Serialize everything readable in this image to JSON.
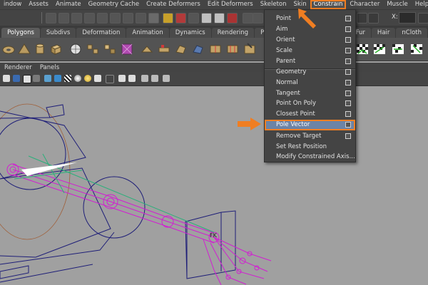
{
  "menubar": {
    "items": [
      "indow",
      "Assets",
      "Animate",
      "Geometry Cache",
      "Create Deformers",
      "Edit Deformers",
      "Skeleton",
      "Skin",
      "Constrain",
      "Character",
      "Muscle",
      "Help"
    ],
    "highlighted_index": 8
  },
  "toolbar": {
    "x_label": "X:"
  },
  "shelf_tabs": [
    "Polygons",
    "Subdivs",
    "Deformation",
    "Animation",
    "Dynamics",
    "Rendering",
    "PaintEffects",
    "Fur",
    "Hair",
    "nCloth"
  ],
  "shelf_active_index": 0,
  "panel_menu": [
    "Renderer",
    "Panels"
  ],
  "constrain_menu": {
    "items": [
      {
        "label": "Point",
        "option_box": true
      },
      {
        "label": "Aim",
        "option_box": true
      },
      {
        "label": "Orient",
        "option_box": true
      },
      {
        "label": "Scale",
        "option_box": true
      },
      {
        "label": "Parent",
        "option_box": true
      },
      {
        "label": "Geometry",
        "option_box": true
      },
      {
        "label": "Normal",
        "option_box": true
      },
      {
        "label": "Tangent",
        "option_box": true
      },
      {
        "label": "Point On Poly",
        "option_box": true
      },
      {
        "label": "Closest Point",
        "option_box": true
      },
      {
        "label": "Pole Vector",
        "option_box": true
      },
      {
        "label": "Remove Target",
        "option_box": true
      },
      {
        "label": "Set Rest Position",
        "option_box": false
      },
      {
        "label": "Modify Constrained Axis...",
        "option_box": false
      }
    ],
    "highlighted": "Pole Vector"
  },
  "viewport": {
    "fk_label": "FK"
  },
  "colors": {
    "accent_orange": "#f07e22",
    "menu_highlight": "#6d84a6",
    "joint_magenta": "#d21ed2",
    "wire_navy": "#1e1e78"
  }
}
